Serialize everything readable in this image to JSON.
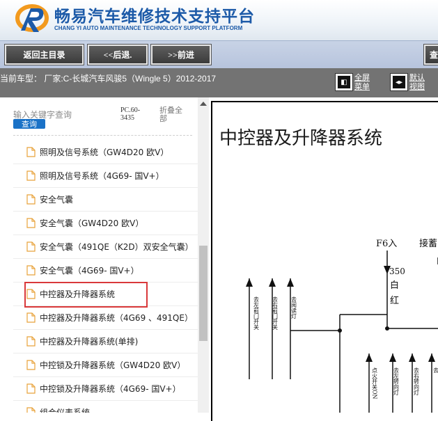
{
  "header": {
    "title": "畅易汽车维修技术支持平台",
    "subtitle": "CHANG YI AUTO MAINTENANCE TECHNOLOGY SUPPORT PLATFORM"
  },
  "toolbar": {
    "home_label": "返回主目录",
    "back_label": "<<后退.",
    "forward_label": ">>前进",
    "search_label": "查"
  },
  "model_bar": {
    "text": "当前车型：  厂家:C-长城汽车风骏5（Wingle 5）2012-2017",
    "fullscreen_label": "全屏菜单",
    "default_view_label": "默认视图"
  },
  "sidebar": {
    "search_hint": "输入关键字查询",
    "search_button": "查询",
    "code": "PC.60-3435",
    "collapse_label": "折叠全部",
    "items": [
      {
        "label": "照明及信号系统（GW4D20 欧V）"
      },
      {
        "label": "照明及信号系统（4G69- 国V+）"
      },
      {
        "label": "安全气囊"
      },
      {
        "label": "安全气囊（GW4D20 欧V）"
      },
      {
        "label": "安全气囊（491QE（K2D）双安全气囊）"
      },
      {
        "label": "安全气囊（4G69- 国V+）"
      },
      {
        "label": "中控器及升降器系统"
      },
      {
        "label": "中控器及升降器系统（4G69 、491QE）"
      },
      {
        "label": "中控器及升降器系统(单排)"
      },
      {
        "label": "中控锁及升降器系统（GW4D20 欧V）"
      },
      {
        "label": "中控锁及升降器系统（4G69- 国V+）"
      },
      {
        "label": "组合仪表系统"
      }
    ],
    "selected_index": 6
  },
  "document": {
    "title": "中控器及升降器系统",
    "diagram": {
      "fuse_label": "F6入",
      "connect_label": "接蓄电",
      "wire_number": "350",
      "wire_color_1": "白",
      "wire_color_2": "红",
      "top_labels": [
        "去左前门开关",
        "去右前门开关",
        "去阅读灯"
      ],
      "bottom_labels": [
        "点火开关ON",
        "去左转向灯",
        "去右转向灯",
        "去"
      ]
    }
  },
  "colors": {
    "brand_blue": "#1c5aa8",
    "toolbar_button": "#4a4a4a",
    "model_bar": "#737373",
    "search_button": "#1a72c7",
    "highlight_border": "#d9383a"
  }
}
